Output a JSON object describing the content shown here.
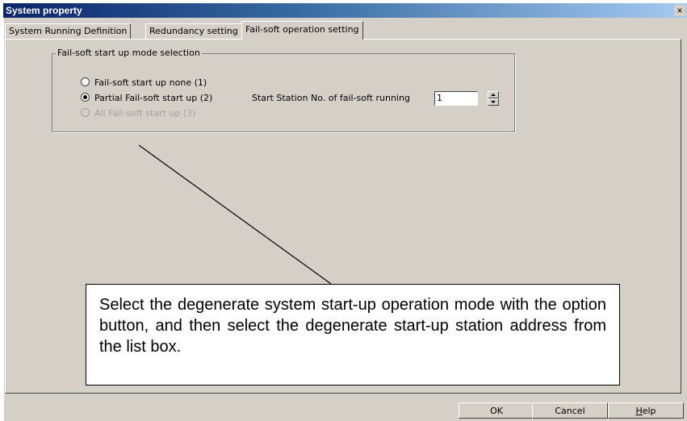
{
  "window": {
    "title": "System property",
    "close_glyph": "×"
  },
  "tabs": [
    {
      "label": "System Running Definition"
    },
    {
      "label": "Redundancy setting"
    },
    {
      "label": "Fail-soft operation setting"
    }
  ],
  "active_tab": "Fail-soft operation setting",
  "group": {
    "title": "Fail-soft start up mode selection",
    "options": [
      {
        "label": "Fail-soft start up none (1)",
        "selected": false,
        "enabled": true
      },
      {
        "label": "Partial Fail-soft start up (2)",
        "selected": true,
        "enabled": true
      },
      {
        "label": "All Fail-soft start up (3)",
        "selected": false,
        "enabled": false
      }
    ]
  },
  "start_station": {
    "label": "Start Station No. of fail-soft running",
    "value": "1"
  },
  "callout": {
    "text": "Select the degenerate system start-up operation mode with the option button, and then select the degenerate start-up station address from the list box."
  },
  "buttons": {
    "ok": "OK",
    "cancel": "Cancel",
    "help_first": "H",
    "help_rest": "elp"
  },
  "icons": {
    "close": "close-icon",
    "radio": "radio-button-icon",
    "spin_up": "spin-up-icon",
    "spin_down": "spin-down-icon"
  }
}
